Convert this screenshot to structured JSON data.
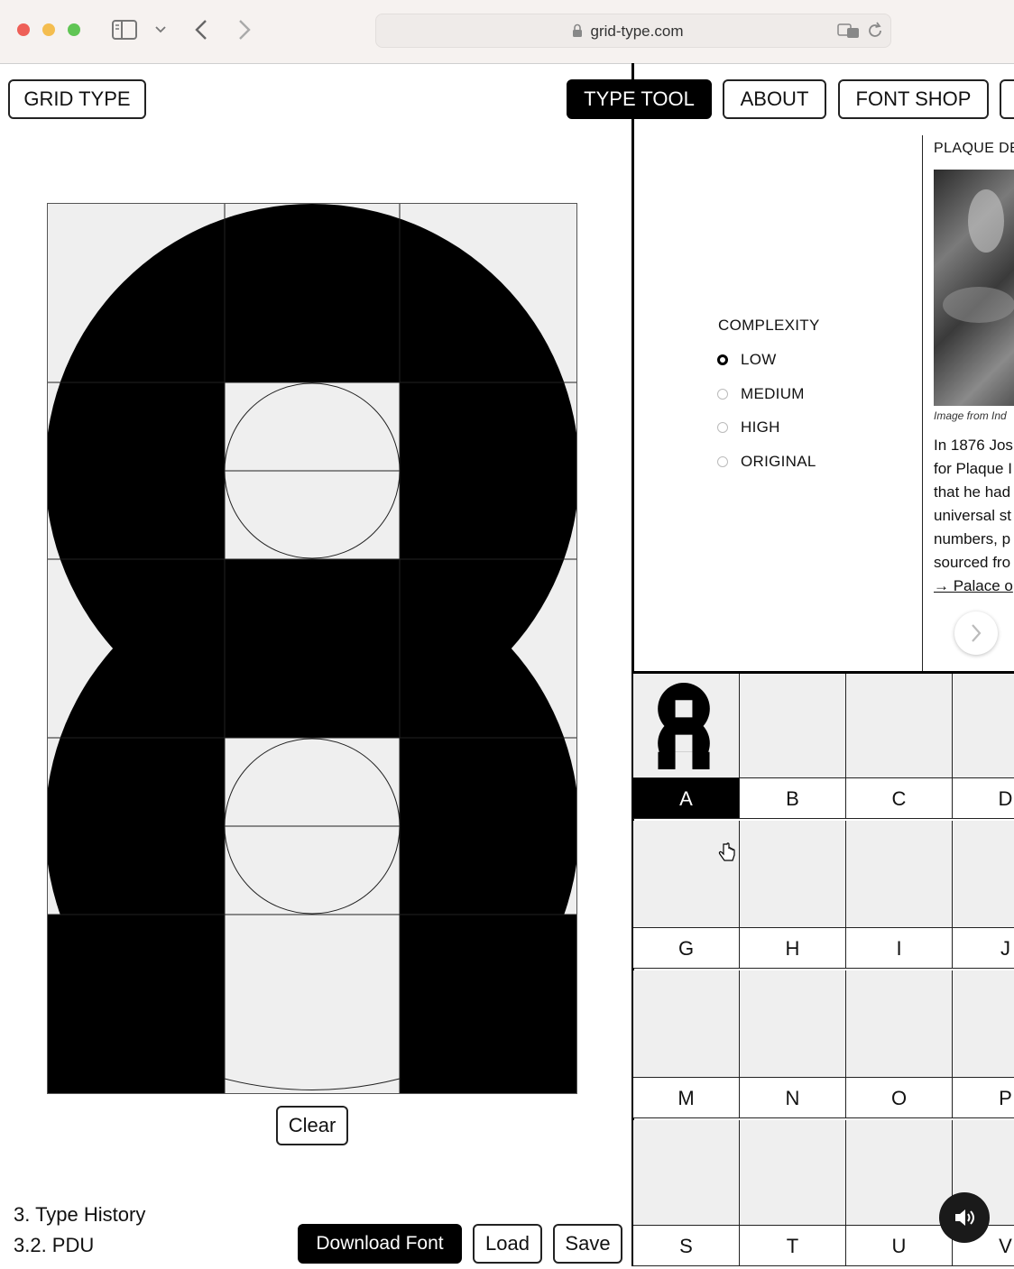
{
  "browser": {
    "url": "grid-type.com"
  },
  "nav": {
    "logo": "GRID TYPE",
    "type_tool": "TYPE TOOL",
    "about": "ABOUT",
    "font_shop": "FONT SHOP"
  },
  "editor": {
    "clear_label": "Clear",
    "section": "3. Type History",
    "subsection": "3.2. PDU",
    "download_label": "Download Font",
    "load_label": "Load",
    "save_label": "Save"
  },
  "complexity": {
    "title": "COMPLEXITY",
    "options": [
      "LOW",
      "MEDIUM",
      "HIGH",
      "ORIGINAL"
    ],
    "selected": "LOW"
  },
  "info": {
    "title": "PLAQUE DE",
    "caption": "Image from Ind",
    "lines": [
      "In 1876 Jos",
      "for Plaque I",
      "that he had",
      "universal st",
      "numbers, p",
      "sourced fro"
    ],
    "link": "→ Palace o"
  },
  "glyph_grid": {
    "rows": [
      [
        "A",
        "B",
        "C",
        "D"
      ],
      [
        "G",
        "H",
        "I",
        "J"
      ],
      [
        "M",
        "N",
        "O",
        "P"
      ],
      [
        "S",
        "T",
        "U",
        "V"
      ]
    ],
    "selected": "A"
  },
  "colors": {
    "ink": "#000000",
    "cell_bg": "#efefef",
    "chrome_bg": "#f6f2f0"
  }
}
